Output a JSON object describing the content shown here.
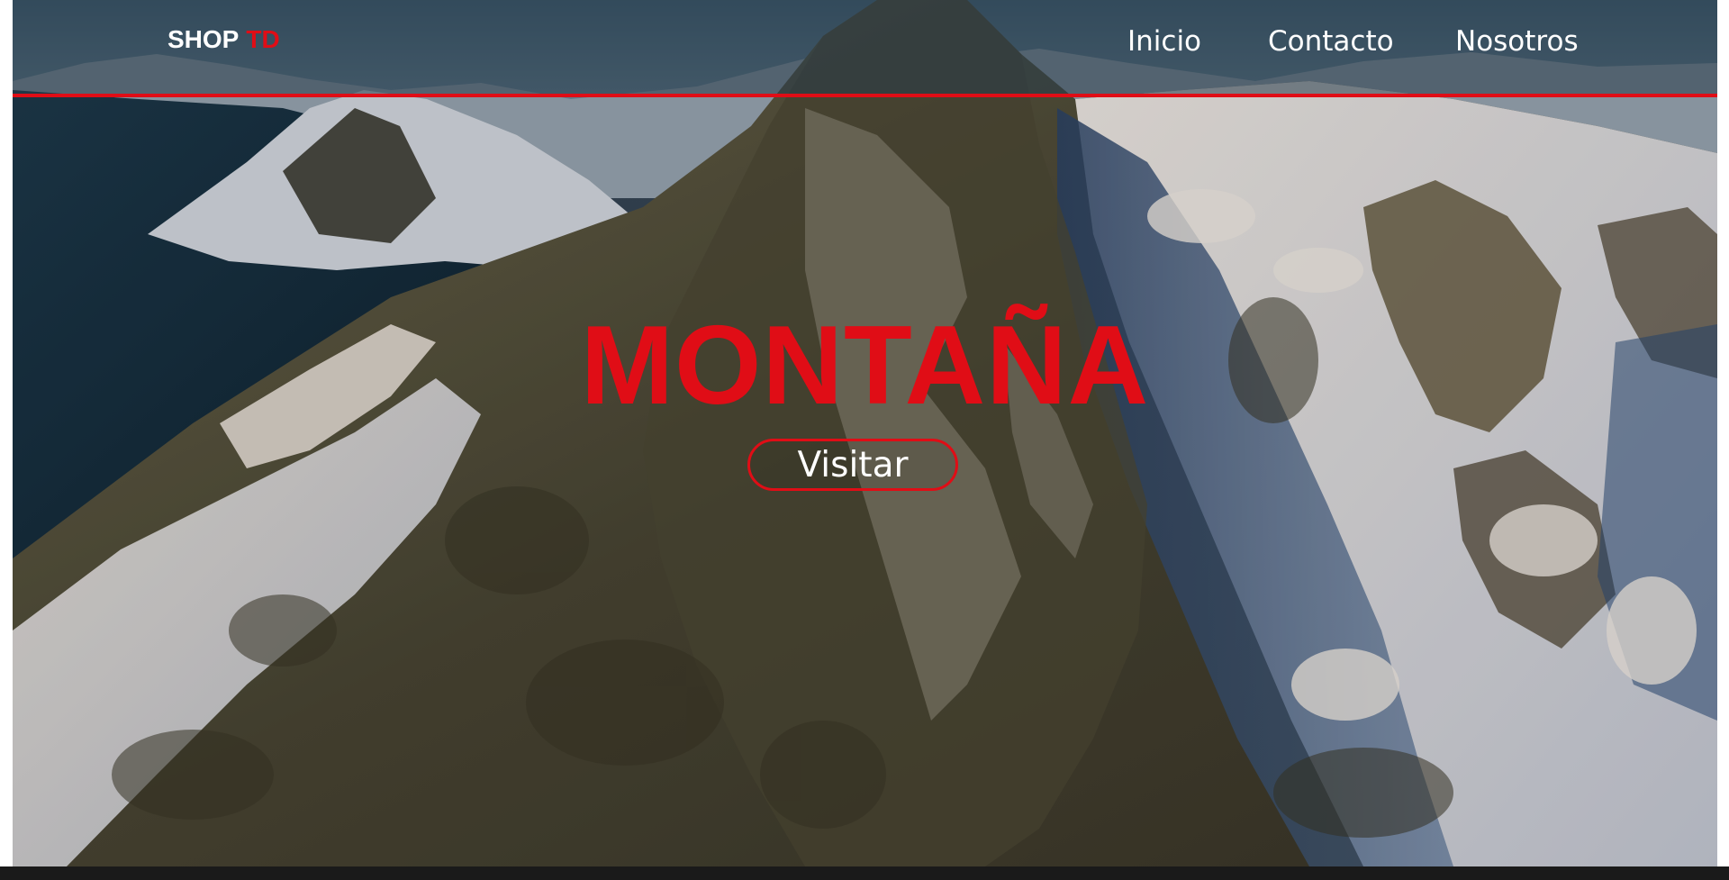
{
  "brand": {
    "name": "SHOP",
    "accent": "TD",
    "accent_color": "#e00d16"
  },
  "nav": {
    "items": [
      {
        "label": "Inicio"
      },
      {
        "label": "Contacto"
      },
      {
        "label": "Nosotros"
      }
    ]
  },
  "hero": {
    "title": "MONTAÑA",
    "cta_label": "Visitar",
    "background": "mountain-photo"
  },
  "colors": {
    "accent": "#e00d16",
    "text": "#ffffff"
  }
}
